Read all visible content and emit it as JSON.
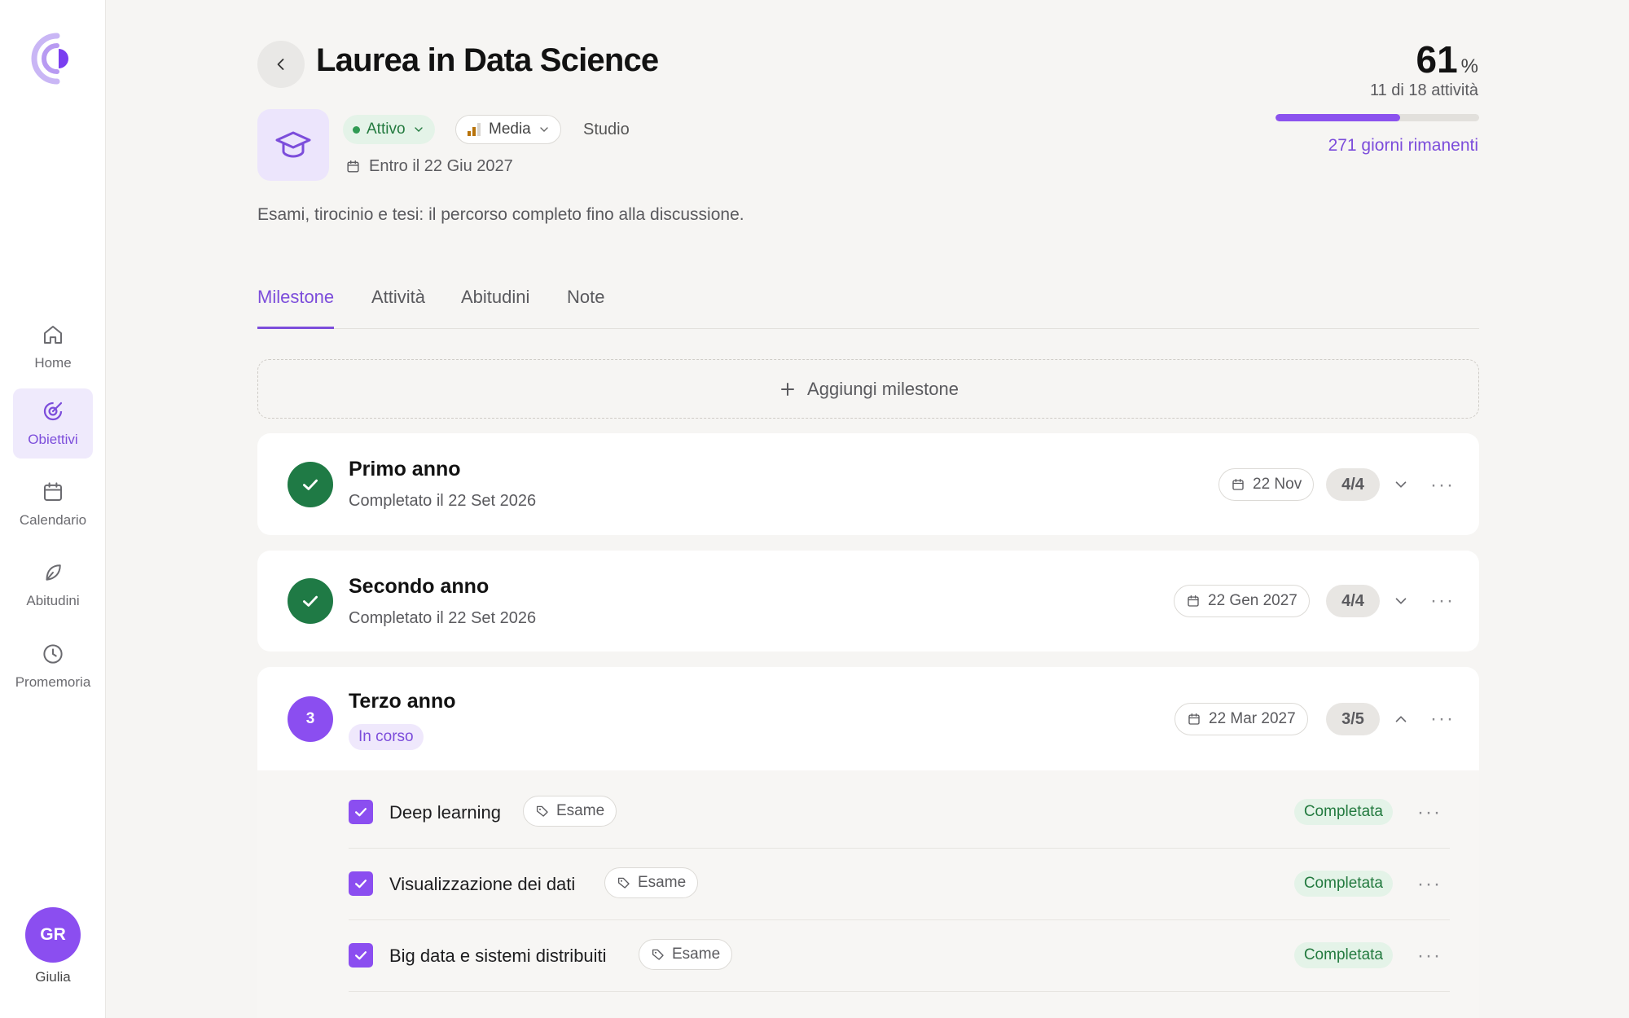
{
  "nav": {
    "items": [
      {
        "label": "Home",
        "icon": "home-icon"
      },
      {
        "label": "Obiettivi",
        "icon": "target-icon",
        "active": true
      },
      {
        "label": "Calendario",
        "icon": "calendar-icon"
      },
      {
        "label": "Abitudini",
        "icon": "leaf-icon"
      },
      {
        "label": "Promemoria",
        "icon": "clock-icon"
      }
    ],
    "user": {
      "initials": "GR",
      "name": "Giulia"
    }
  },
  "goal": {
    "title": "Laurea in Data Science",
    "icon": "graduation-cap-icon",
    "status": "Attivo",
    "priority": "Media",
    "category": "Studio",
    "deadline": "Entro il 22 Giu 2027",
    "description": "Esami, tirocinio e tesi: il percorso completo fino alla discussione."
  },
  "progress": {
    "percent": "61",
    "percent_sign": "%",
    "fraction": 0.61,
    "activities": "11 di 18 attività",
    "days_left": "271 giorni rimanenti"
  },
  "tabs": [
    "Milestone",
    "Attività",
    "Abitudini",
    "Note"
  ],
  "add_milestone_label": "Aggiungi milestone",
  "milestones": [
    {
      "title": "Primo anno",
      "subtitle": "Completato il 22 Set 2026",
      "date": "22 Nov",
      "count": "4/4",
      "state": "done"
    },
    {
      "title": "Secondo anno",
      "subtitle": "Completato il 22 Set 2026",
      "date": "22 Gen 2027",
      "count": "4/4",
      "state": "done"
    },
    {
      "title": "Terzo anno",
      "number": "3",
      "badge": "In corso",
      "date": "22 Mar 2027",
      "count": "3/5",
      "state": "in-progress"
    }
  ],
  "tasks": [
    {
      "name": "Deep learning",
      "tag": "Esame",
      "status": "Completata"
    },
    {
      "name": "Visualizzazione dei dati",
      "tag": "Esame",
      "status": "Completata"
    },
    {
      "name": "Big data e sistemi distribuiti",
      "tag": "Esame",
      "status": "Completata"
    }
  ],
  "colors": {
    "accent": "#8b4ef0",
    "success": "#1f7a45",
    "background": "#f6f5f3"
  }
}
